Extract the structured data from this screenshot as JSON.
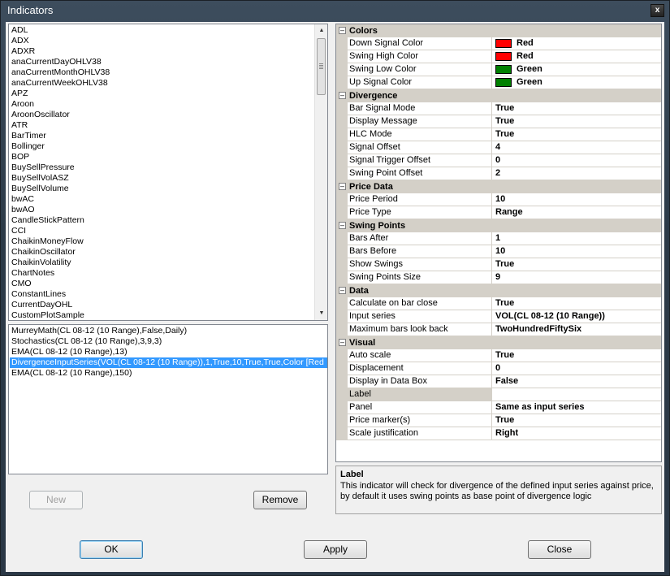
{
  "window": {
    "title": "Indicators",
    "close": "x"
  },
  "indicators": [
    "ADL",
    "ADX",
    "ADXR",
    "anaCurrentDayOHLV38",
    "anaCurrentMonthOHLV38",
    "anaCurrentWeekOHLV38",
    "APZ",
    "Aroon",
    "AroonOscillator",
    "ATR",
    "BarTimer",
    "Bollinger",
    "BOP",
    "BuySellPressure",
    "BuySellVolASZ",
    "BuySellVolume",
    "bwAC",
    "bwAO",
    "CandleStickPattern",
    "CCI",
    "ChaikinMoneyFlow",
    "ChaikinOscillator",
    "ChaikinVolatility",
    "ChartNotes",
    "CMO",
    "ConstantLines",
    "CurrentDayOHL",
    "CustomPlotSample"
  ],
  "applied": [
    "MurreyMath(CL 08-12 (10 Range),False,Daily)",
    "Stochastics(CL 08-12 (10 Range),3,9,3)",
    "EMA(CL 08-12 (10 Range),13)",
    "DivergenceInputSeries(VOL(CL 08-12 (10 Range)),1,True,10,True,True,Color [Red",
    "EMA(CL 08-12 (10 Range),150)"
  ],
  "applied_selected_index": 3,
  "buttons": {
    "new": "New",
    "remove": "Remove",
    "ok": "OK",
    "apply": "Apply",
    "close": "Close"
  },
  "colors": {
    "red": "#ff0000",
    "green": "#008000",
    "selection": "#3399ff"
  },
  "property_grid": [
    {
      "category": "Colors",
      "toggle": "⊟",
      "props": [
        {
          "name": "Down Signal Color",
          "value": "Red",
          "swatch": "#ff0000"
        },
        {
          "name": "Swing High Color",
          "value": "Red",
          "swatch": "#ff0000"
        },
        {
          "name": "Swing Low Color",
          "value": "Green",
          "swatch": "#008000"
        },
        {
          "name": "Up Signal Color",
          "value": "Green",
          "swatch": "#008000"
        }
      ]
    },
    {
      "category": "Divergence",
      "toggle": "⊟",
      "props": [
        {
          "name": "Bar Signal Mode",
          "value": "True"
        },
        {
          "name": "Display Message",
          "value": "True"
        },
        {
          "name": "HLC Mode",
          "value": "True"
        },
        {
          "name": "Signal Offset",
          "value": "4"
        },
        {
          "name": "Signal Trigger Offset",
          "value": "0"
        },
        {
          "name": "Swing Point Offset",
          "value": "2"
        }
      ]
    },
    {
      "category": "Price Data",
      "toggle": "⊟",
      "props": [
        {
          "name": "Price Period",
          "value": "10"
        },
        {
          "name": "Price Type",
          "value": "Range"
        }
      ]
    },
    {
      "category": "Swing Points",
      "toggle": "⊟",
      "props": [
        {
          "name": "Bars After",
          "value": "1"
        },
        {
          "name": "Bars Before",
          "value": "10"
        },
        {
          "name": "Show Swings",
          "value": "True"
        },
        {
          "name": "Swing Points Size",
          "value": "9"
        }
      ]
    },
    {
      "category": "Data",
      "toggle": "⊟",
      "props": [
        {
          "name": "Calculate on bar close",
          "value": "True"
        },
        {
          "name": "Input series",
          "value": "VOL(CL 08-12 (10 Range))"
        },
        {
          "name": "Maximum bars look back",
          "value": "TwoHundredFiftySix"
        }
      ]
    },
    {
      "category": "Visual",
      "toggle": "⊟",
      "props": [
        {
          "name": "Auto scale",
          "value": "True"
        },
        {
          "name": "Displacement",
          "value": "0"
        },
        {
          "name": "Display in Data Box",
          "value": "False"
        },
        {
          "name": "Label",
          "value": "",
          "selected": true
        },
        {
          "name": "Panel",
          "value": "Same as input series"
        },
        {
          "name": "Price marker(s)",
          "value": "True"
        },
        {
          "name": "Scale justification",
          "value": "Right"
        }
      ]
    }
  ],
  "help": {
    "title": "Label",
    "description": "This indicator will check for divergence of the defined input series against price, by default it uses swing points as base point of divergence logic"
  }
}
